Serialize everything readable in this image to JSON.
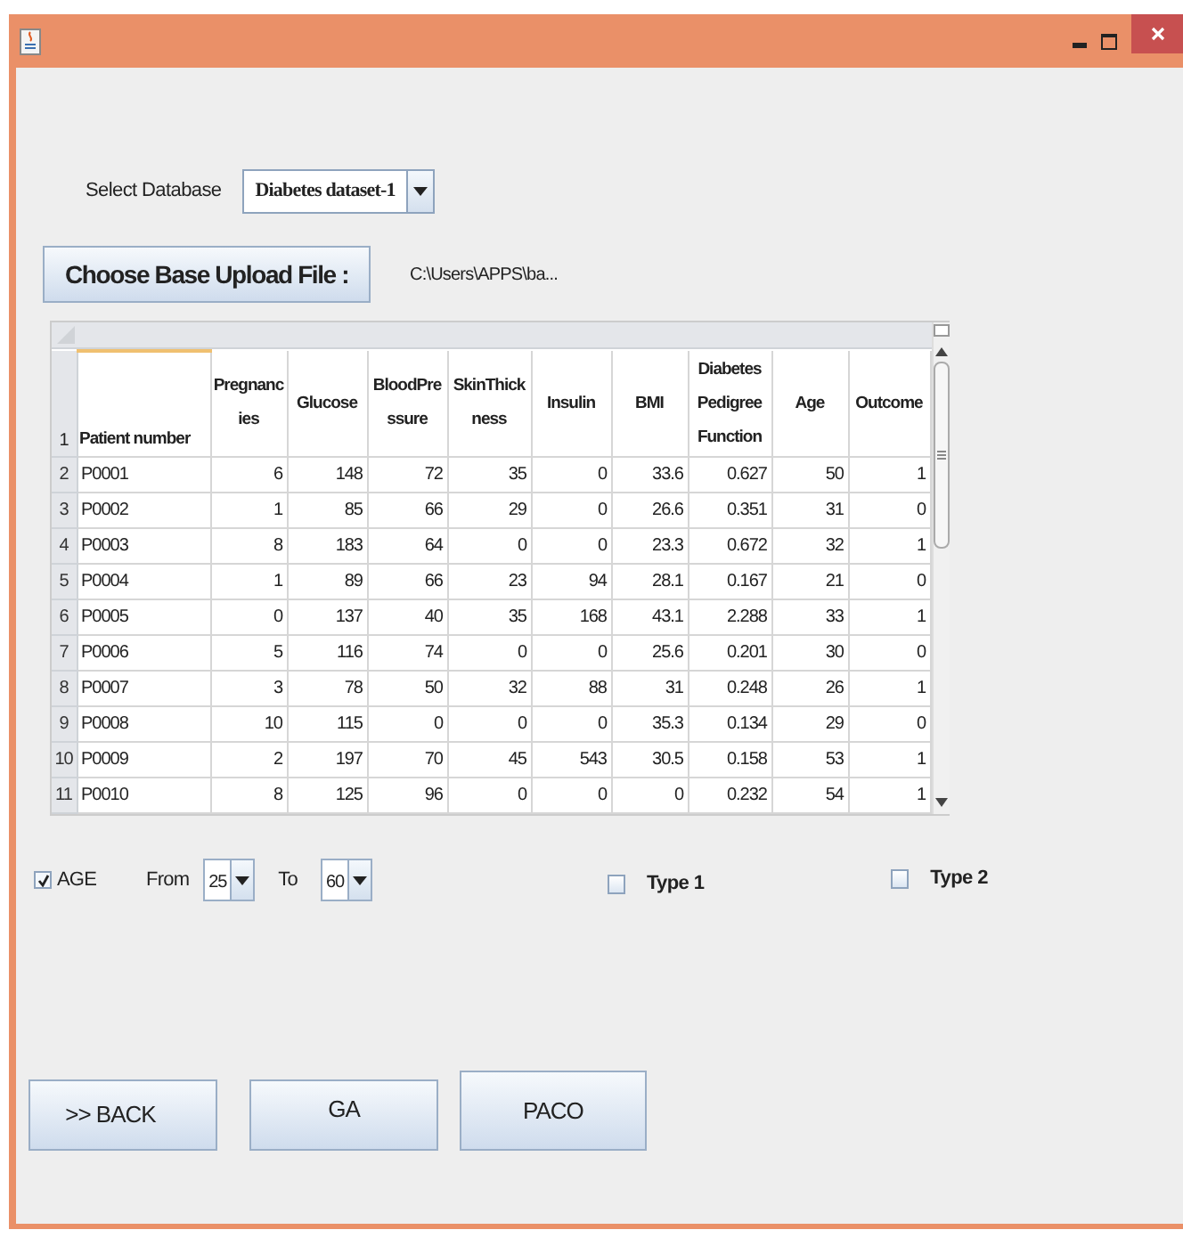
{
  "database": {
    "label": "Select Database",
    "value": "Diabetes dataset-1"
  },
  "upload": {
    "button": "Choose Base Upload File :",
    "path": "C:\\Users\\APPS\\ba..."
  },
  "table": {
    "header_number": "1",
    "columns": [
      "Patient number",
      "Pregnancies",
      "Glucose",
      "BloodPressure",
      "SkinThickness",
      "Insulin",
      "BMI",
      "Diabetes Pedigree Function",
      "Age",
      "Outcome"
    ],
    "rows": [
      {
        "number": "2",
        "cells": [
          "P0001",
          "6",
          "148",
          "72",
          "35",
          "0",
          "33.6",
          "0.627",
          "50",
          "1"
        ]
      },
      {
        "number": "3",
        "cells": [
          "P0002",
          "1",
          "85",
          "66",
          "29",
          "0",
          "26.6",
          "0.351",
          "31",
          "0"
        ]
      },
      {
        "number": "4",
        "cells": [
          "P0003",
          "8",
          "183",
          "64",
          "0",
          "0",
          "23.3",
          "0.672",
          "32",
          "1"
        ]
      },
      {
        "number": "5",
        "cells": [
          "P0004",
          "1",
          "89",
          "66",
          "23",
          "94",
          "28.1",
          "0.167",
          "21",
          "0"
        ]
      },
      {
        "number": "6",
        "cells": [
          "P0005",
          "0",
          "137",
          "40",
          "35",
          "168",
          "43.1",
          "2.288",
          "33",
          "1"
        ]
      },
      {
        "number": "7",
        "cells": [
          "P0006",
          "5",
          "116",
          "74",
          "0",
          "0",
          "25.6",
          "0.201",
          "30",
          "0"
        ]
      },
      {
        "number": "8",
        "cells": [
          "P0007",
          "3",
          "78",
          "50",
          "32",
          "88",
          "31",
          "0.248",
          "26",
          "1"
        ]
      },
      {
        "number": "9",
        "cells": [
          "P0008",
          "10",
          "115",
          "0",
          "0",
          "0",
          "35.3",
          "0.134",
          "29",
          "0"
        ]
      },
      {
        "number": "10",
        "cells": [
          "P0009",
          "2",
          "197",
          "70",
          "45",
          "543",
          "30.5",
          "0.158",
          "53",
          "1"
        ]
      },
      {
        "number": "11",
        "cells": [
          "P0010",
          "8",
          "125",
          "96",
          "0",
          "0",
          "0",
          "0.232",
          "54",
          "1"
        ]
      }
    ]
  },
  "filters": {
    "age": {
      "label": "AGE",
      "checked": true,
      "from_label": "From",
      "from": "25",
      "to_label": "To",
      "to": "60"
    },
    "types": [
      {
        "label": "Type 1",
        "checked": false
      },
      {
        "label": "Type 2",
        "checked": false
      }
    ]
  },
  "buttons": [
    ">> BACK",
    "GA",
    "PACO"
  ]
}
